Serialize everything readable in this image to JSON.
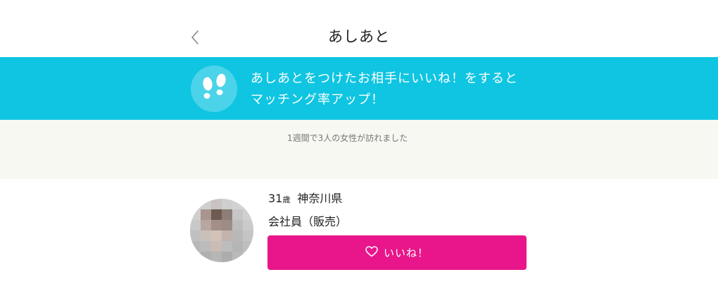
{
  "header": {
    "title": "あしあと",
    "back_icon": "chevron-left-icon"
  },
  "banner": {
    "icon": "footprints-icon",
    "line1": "あしあとをつけたお相手にいいね！をすると",
    "line2": "マッチング率アップ！",
    "background": "#0fc5e2"
  },
  "summary": {
    "text": "1週間で3人の女性が訪れました",
    "background": "#f7f8f2"
  },
  "users": [
    {
      "age": "31",
      "age_unit": "歳",
      "location": "神奈川県",
      "job": "会社員（販売）",
      "avatar": "pixelated-photo",
      "like_label": "いいね！",
      "like_icon": "heart-outline-icon",
      "like_color": "#e8168a"
    }
  ]
}
